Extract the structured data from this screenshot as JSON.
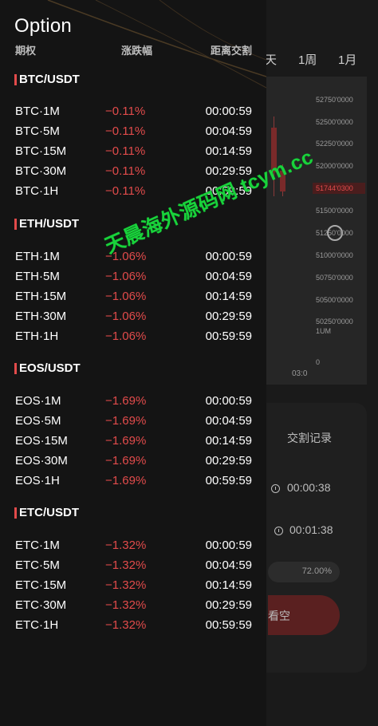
{
  "background": {
    "period_tabs": [
      "天",
      "1周",
      "1月"
    ],
    "price_labels": [
      "52750'0000",
      "52500'0000",
      "52250'0000",
      "52000'0000",
      "51500'0000",
      "51250'0000",
      "51000'0000",
      "50750'0000",
      "50500'0000",
      "50250'0000"
    ],
    "current_price": "51744'0300",
    "volume_label": "1UM",
    "volume_zero": "0",
    "time_label": "03:0",
    "trade_panel": {
      "record_label": "交割记录",
      "timer_1": "00:00:38",
      "timer_2": "00:01:38",
      "progress_text": "72.00%",
      "sell_label": "看空"
    }
  },
  "drawer": {
    "title": "Option",
    "headers": {
      "name": "期权",
      "change": "涨跌幅",
      "countdown": "距离交割"
    },
    "sections": [
      {
        "title": "BTC/USDT",
        "rows": [
          {
            "name": "BTC·1M",
            "change": "−0.11%",
            "time": "00:00:59"
          },
          {
            "name": "BTC·5M",
            "change": "−0.11%",
            "time": "00:04:59"
          },
          {
            "name": "BTC·15M",
            "change": "−0.11%",
            "time": "00:14:59"
          },
          {
            "name": "BTC·30M",
            "change": "−0.11%",
            "time": "00:29:59"
          },
          {
            "name": "BTC·1H",
            "change": "−0.11%",
            "time": "00:59:59"
          }
        ]
      },
      {
        "title": "ETH/USDT",
        "rows": [
          {
            "name": "ETH·1M",
            "change": "−1.06%",
            "time": "00:00:59"
          },
          {
            "name": "ETH·5M",
            "change": "−1.06%",
            "time": "00:04:59"
          },
          {
            "name": "ETH·15M",
            "change": "−1.06%",
            "time": "00:14:59"
          },
          {
            "name": "ETH·30M",
            "change": "−1.06%",
            "time": "00:29:59"
          },
          {
            "name": "ETH·1H",
            "change": "−1.06%",
            "time": "00:59:59"
          }
        ]
      },
      {
        "title": "EOS/USDT",
        "rows": [
          {
            "name": "EOS·1M",
            "change": "−1.69%",
            "time": "00:00:59"
          },
          {
            "name": "EOS·5M",
            "change": "−1.69%",
            "time": "00:04:59"
          },
          {
            "name": "EOS·15M",
            "change": "−1.69%",
            "time": "00:14:59"
          },
          {
            "name": "EOS·30M",
            "change": "−1.69%",
            "time": "00:29:59"
          },
          {
            "name": "EOS·1H",
            "change": "−1.69%",
            "time": "00:59:59"
          }
        ]
      },
      {
        "title": "ETC/USDT",
        "rows": [
          {
            "name": "ETC·1M",
            "change": "−1.32%",
            "time": "00:00:59"
          },
          {
            "name": "ETC·5M",
            "change": "−1.32%",
            "time": "00:04:59"
          },
          {
            "name": "ETC·15M",
            "change": "−1.32%",
            "time": "00:14:59"
          },
          {
            "name": "ETC·30M",
            "change": "−1.32%",
            "time": "00:29:59"
          },
          {
            "name": "ETC·1H",
            "change": "−1.32%",
            "time": "00:59:59"
          }
        ]
      }
    ]
  },
  "watermark": "天晨海外源码网 tcym.cc",
  "colors": {
    "accent_red": "#e24b4b",
    "watermark_green": "#19d23b",
    "drawer_bg": "#141414"
  }
}
